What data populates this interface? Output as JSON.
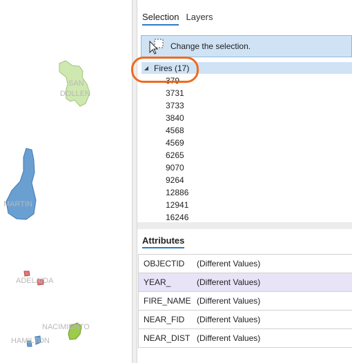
{
  "panel": {
    "tabs": [
      {
        "label": "Selection"
      },
      {
        "label": "Layers"
      }
    ],
    "info_bar_text": "Change the selection.",
    "tree": {
      "layer_label": "Fires (17)",
      "items": [
        "379",
        "3731",
        "3733",
        "3840",
        "4568",
        "4569",
        "6265",
        "9070",
        "9264",
        "12886",
        "12941",
        "16246"
      ]
    },
    "attributes": {
      "title": "Attributes",
      "rows": [
        {
          "name": "OBJECTID",
          "value": "(Different Values)"
        },
        {
          "name": "YEAR_",
          "value": "(Different Values)"
        },
        {
          "name": "FIRE_NAME",
          "value": "(Different Values)"
        },
        {
          "name": "NEAR_FID",
          "value": "(Different Values)"
        },
        {
          "name": "NEAR_DIST",
          "value": "(Different Values)"
        }
      ]
    }
  },
  "map": {
    "labels": [
      "SAN",
      "DOLLEN",
      "MARTIN",
      "ADELAIDA",
      "NACIMIENTO",
      "HAMILTON"
    ]
  },
  "colors": {
    "accent": "#2a7ac6",
    "annotation": "#ef6a1e",
    "selection_fill": "#cfe3f5",
    "row_highlight": "#e8e3f7",
    "polygon_green": "#cfe8b0",
    "polygon_blue": "#6a9fd2",
    "polygon_red": "#e07a7a",
    "polygon_lime": "#9ccc4a"
  }
}
